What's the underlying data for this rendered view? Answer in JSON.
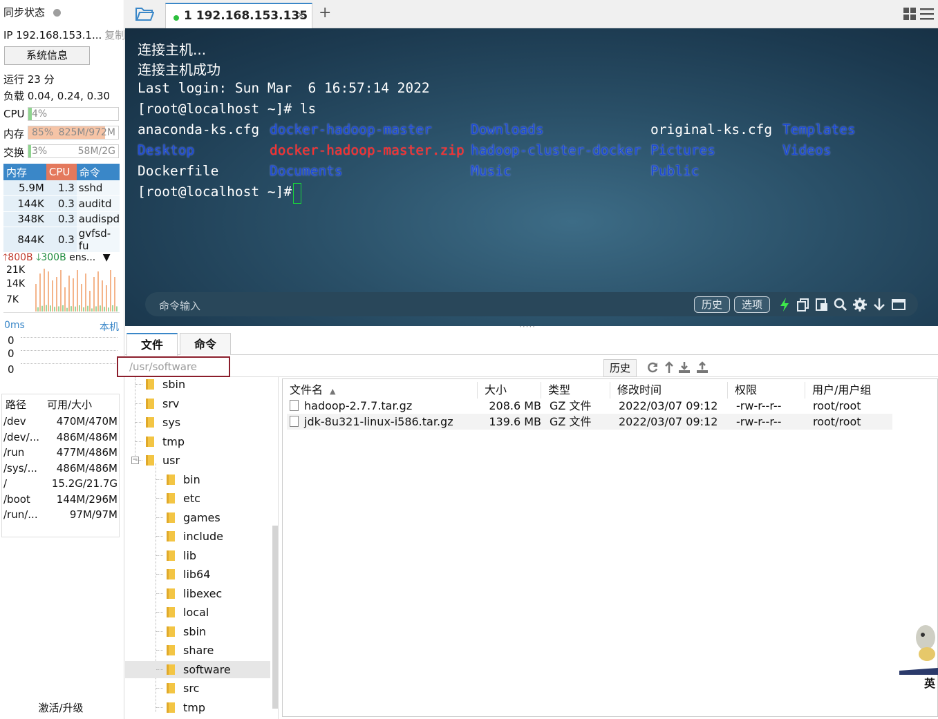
{
  "sidebar": {
    "sync_label": "同步状态",
    "ip_label": "IP 192.168.153.1...",
    "copy_label": "复制",
    "sysinfo_button": "系统信息",
    "uptime": "运行 23 分",
    "load": "负载 0.04, 0.24, 0.30",
    "cpu_label": "CPU",
    "cpu_value": "4%",
    "cpu_fraction": 0.04,
    "mem_label": "内存",
    "mem_percent": "85%",
    "mem_value": "825M/972M",
    "mem_fraction": 0.85,
    "swap_label": "交换",
    "swap_percent": "3%",
    "swap_value": "58M/2G",
    "swap_fraction": 0.03,
    "proc_headers": [
      "内存",
      "CPU",
      "命令"
    ],
    "processes": [
      {
        "mem": "5.9M",
        "cpu": "1.3",
        "cmd": "sshd"
      },
      {
        "mem": "144K",
        "cpu": "0.3",
        "cmd": "auditd"
      },
      {
        "mem": "348K",
        "cpu": "0.3",
        "cmd": "audispd"
      },
      {
        "mem": "844K",
        "cpu": "0.3",
        "cmd": "gvfsd-fu"
      }
    ],
    "net_up": "800B",
    "net_down": "300B",
    "net_iface": "ens...",
    "net_scale": [
      "21K",
      "14K",
      "7K"
    ],
    "latency_label": "0ms",
    "latency_host": "本机",
    "latency_values": [
      "0",
      "0",
      "0"
    ],
    "disk_headers": [
      "路径",
      "可用/大小"
    ],
    "disks": [
      {
        "path": "/dev",
        "size": "470M/470M"
      },
      {
        "path": "/dev/...",
        "size": "486M/486M"
      },
      {
        "path": "/run",
        "size": "477M/486M"
      },
      {
        "path": "/sys/...",
        "size": "486M/486M"
      },
      {
        "path": "/",
        "size": "15.2G/21.7G"
      },
      {
        "path": "/boot",
        "size": "144M/296M"
      },
      {
        "path": "/run/...",
        "size": "97M/97M"
      }
    ],
    "activate_label": "激活/升级"
  },
  "tabs": {
    "session_title": "1 192.168.153.135",
    "close_glyph": "×",
    "add_glyph": "+"
  },
  "terminal": {
    "lines": [
      "连接主机...",
      "连接主机成功",
      "Last login: Sun Mar  6 16:57:14 2022",
      "[root@localhost ~]# ls"
    ],
    "ls_items": [
      {
        "name": "anaconda-ks.cfg",
        "kind": "file"
      },
      {
        "name": "docker-hadoop-master",
        "kind": "dir"
      },
      {
        "name": "Downloads",
        "kind": "dir"
      },
      {
        "name": "original-ks.cfg",
        "kind": "file"
      },
      {
        "name": "Templates",
        "kind": "dir"
      },
      {
        "name": "Desktop",
        "kind": "dir"
      },
      {
        "name": "docker-hadoop-master.zip",
        "kind": "zip"
      },
      {
        "name": "hadoop-cluster-docker",
        "kind": "dir"
      },
      {
        "name": "Pictures",
        "kind": "dir"
      },
      {
        "name": "Videos",
        "kind": "dir"
      },
      {
        "name": "Dockerfile",
        "kind": "file"
      },
      {
        "name": "Documents",
        "kind": "dir"
      },
      {
        "name": "Music",
        "kind": "dir"
      },
      {
        "name": "Public",
        "kind": "dir"
      }
    ],
    "prompt": "[root@localhost ~]#",
    "cmd_placeholder": "命令输入",
    "history_button": "历史",
    "options_button": "选项"
  },
  "bottom": {
    "tab_files": "文件",
    "tab_commands": "命令",
    "path": "/usr/software",
    "history_button": "历史",
    "tree": [
      {
        "name": "sbin",
        "level": 1
      },
      {
        "name": "srv",
        "level": 1
      },
      {
        "name": "sys",
        "level": 1
      },
      {
        "name": "tmp",
        "level": 1
      },
      {
        "name": "usr",
        "level": 1
      },
      {
        "name": "bin",
        "level": 2
      },
      {
        "name": "etc",
        "level": 2
      },
      {
        "name": "games",
        "level": 2
      },
      {
        "name": "include",
        "level": 2
      },
      {
        "name": "lib",
        "level": 2
      },
      {
        "name": "lib64",
        "level": 2
      },
      {
        "name": "libexec",
        "level": 2
      },
      {
        "name": "local",
        "level": 2
      },
      {
        "name": "sbin",
        "level": 2
      },
      {
        "name": "share",
        "level": 2
      },
      {
        "name": "software",
        "level": 2,
        "selected": true
      },
      {
        "name": "src",
        "level": 2
      },
      {
        "name": "tmp",
        "level": 2
      }
    ],
    "columns": [
      "文件名",
      "大小",
      "类型",
      "修改时间",
      "权限",
      "用户/用户组"
    ],
    "files": [
      {
        "name": "hadoop-2.7.7.tar.gz",
        "size": "208.6 MB",
        "type": "GZ 文件",
        "mtime": "2022/03/07 09:12",
        "perm": "-rw-r--r--",
        "owner": "root/root"
      },
      {
        "name": "jdk-8u321-linux-i586.tar.gz",
        "size": "139.6 MB",
        "type": "GZ 文件",
        "mtime": "2022/03/07 09:12",
        "perm": "-rw-r--r--",
        "owner": "root/root"
      }
    ],
    "ime_label": "英"
  },
  "colors": {
    "accent": "#3a87c8",
    "cpu_header": "#e4795d",
    "mem_fill": "#f6c4a6",
    "term_dir": "#1b49d6",
    "term_zip": "#ff2a2a",
    "cursor": "#19d43a",
    "path_border": "#8b1d2b"
  }
}
